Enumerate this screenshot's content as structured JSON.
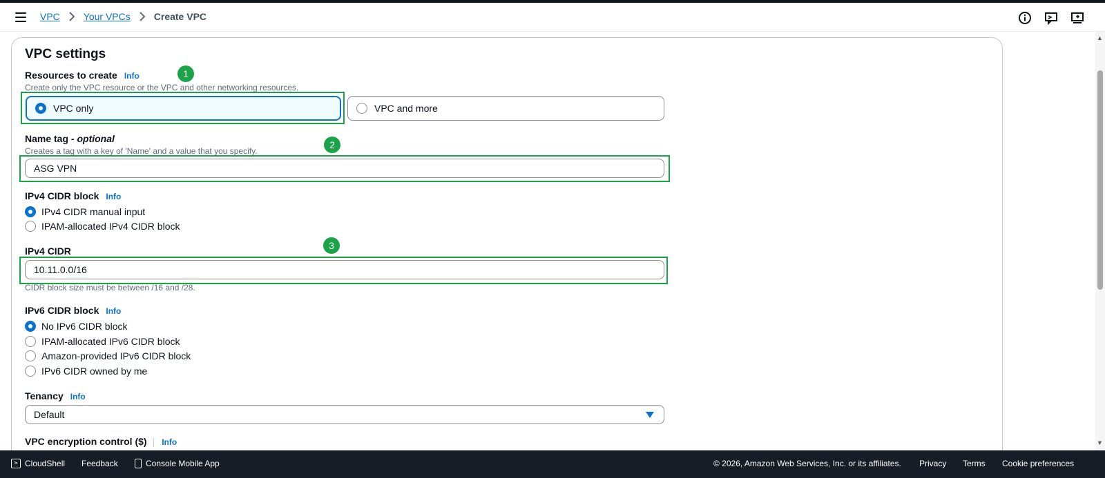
{
  "breadcrumb": {
    "items": [
      "VPC",
      "Your VPCs"
    ],
    "current": "Create VPC"
  },
  "header_icons": [
    "info-circle-icon",
    "feedback-icon",
    "support-icon"
  ],
  "panel": {
    "title": "VPC settings"
  },
  "resources": {
    "label": "Resources to create",
    "info": "Info",
    "description": "Create only the VPC resource or the VPC and other networking resources.",
    "options": [
      "VPC only",
      "VPC and more"
    ],
    "selected": "VPC only"
  },
  "name_tag": {
    "label": "Name tag - ",
    "label_optional": "optional",
    "description": "Creates a tag with a key of 'Name' and a value that you specify.",
    "value": "ASG VPN"
  },
  "ipv4_block": {
    "label": "IPv4 CIDR block",
    "info": "Info",
    "options": [
      "IPv4 CIDR manual input",
      "IPAM-allocated IPv4 CIDR block"
    ],
    "selected": "IPv4 CIDR manual input"
  },
  "ipv4_cidr": {
    "label": "IPv4 CIDR",
    "value": "10.11.0.0/16",
    "hint": "CIDR block size must be between /16 and /28."
  },
  "ipv6_block": {
    "label": "IPv6 CIDR block",
    "info": "Info",
    "options": [
      "No IPv6 CIDR block",
      "IPAM-allocated IPv6 CIDR block",
      "Amazon-provided IPv6 CIDR block",
      "IPv6 CIDR owned by me"
    ],
    "selected": "No IPv6 CIDR block"
  },
  "tenancy": {
    "label": "Tenancy",
    "info": "Info",
    "value": "Default"
  },
  "encryption": {
    "label": "VPC encryption control ($)",
    "info": "Info"
  },
  "annotations": [
    "1",
    "2",
    "3"
  ],
  "colors": {
    "accent": "#0972d3",
    "annotation": "#1ba34a",
    "footer_bg": "#161d26"
  },
  "footer": {
    "cloudshell": "CloudShell",
    "feedback": "Feedback",
    "mobile_app": "Console Mobile App",
    "copyright": "© 2026, Amazon Web Services, Inc. or its affiliates.",
    "privacy": "Privacy",
    "terms": "Terms",
    "cookies": "Cookie preferences"
  }
}
